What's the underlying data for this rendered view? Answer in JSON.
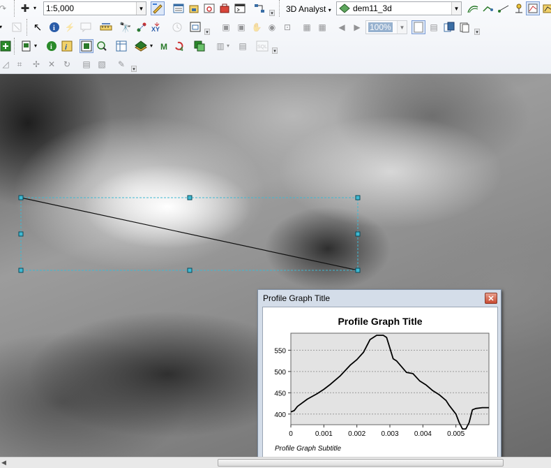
{
  "toolbar": {
    "scale_value": "1:5,000",
    "analyst_label": "3D Analyst",
    "layer_value": "dem11_3d",
    "zoom_value": "100%"
  },
  "profile_window": {
    "window_title": "Profile Graph Title",
    "close_label": "✕"
  },
  "chart_data": {
    "type": "line",
    "title": "Profile Graph Title",
    "subtitle": "Profile Graph Subtitle",
    "xlabel": "",
    "ylabel": "",
    "xlim": [
      0,
      0.006
    ],
    "ylim": [
      375,
      590
    ],
    "x_ticks": [
      "0",
      "0.001",
      "0.002",
      "0.003",
      "0.004",
      "0.005"
    ],
    "y_ticks": [
      "400",
      "450",
      "500",
      "550"
    ],
    "grid": true,
    "x": [
      0,
      0.0001,
      0.0002,
      0.0005,
      0.0008,
      0.001,
      0.0012,
      0.0015,
      0.0018,
      0.002,
      0.0022,
      0.0024,
      0.0026,
      0.0028,
      0.0029,
      0.003,
      0.0031,
      0.0032,
      0.0035,
      0.0037,
      0.0039,
      0.0041,
      0.0043,
      0.0045,
      0.0047,
      0.0048,
      0.005,
      0.0051,
      0.0052,
      0.0053,
      0.0054,
      0.0055,
      0.0056,
      0.0058,
      0.006
    ],
    "series": [
      {
        "values": [
          405,
          408,
          418,
          435,
          448,
          458,
          470,
          490,
          515,
          528,
          545,
          575,
          585,
          585,
          580,
          555,
          530,
          525,
          498,
          495,
          478,
          468,
          455,
          445,
          432,
          420,
          400,
          380,
          365,
          365,
          380,
          410,
          413,
          415,
          415
        ]
      }
    ]
  }
}
